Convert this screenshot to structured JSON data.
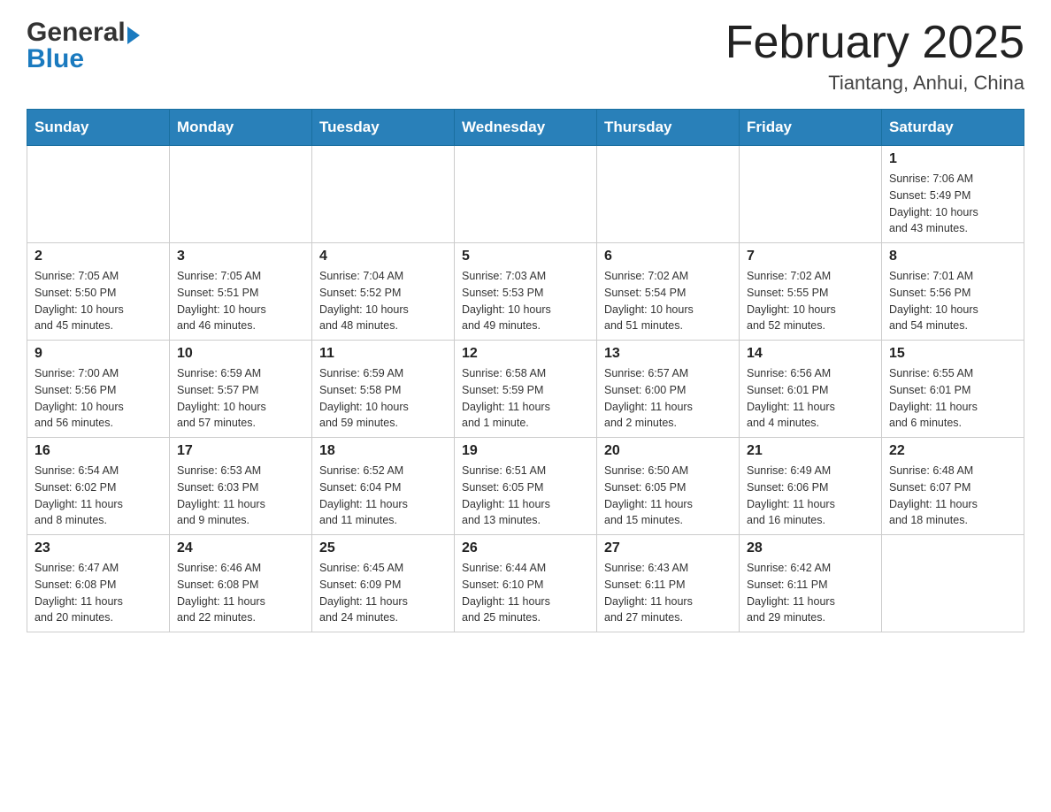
{
  "header": {
    "month_title": "February 2025",
    "location": "Tiantang, Anhui, China",
    "logo_general": "General",
    "logo_blue": "Blue"
  },
  "weekdays": [
    "Sunday",
    "Monday",
    "Tuesday",
    "Wednesday",
    "Thursday",
    "Friday",
    "Saturday"
  ],
  "weeks": [
    [
      {
        "day": "",
        "info": ""
      },
      {
        "day": "",
        "info": ""
      },
      {
        "day": "",
        "info": ""
      },
      {
        "day": "",
        "info": ""
      },
      {
        "day": "",
        "info": ""
      },
      {
        "day": "",
        "info": ""
      },
      {
        "day": "1",
        "info": "Sunrise: 7:06 AM\nSunset: 5:49 PM\nDaylight: 10 hours\nand 43 minutes."
      }
    ],
    [
      {
        "day": "2",
        "info": "Sunrise: 7:05 AM\nSunset: 5:50 PM\nDaylight: 10 hours\nand 45 minutes."
      },
      {
        "day": "3",
        "info": "Sunrise: 7:05 AM\nSunset: 5:51 PM\nDaylight: 10 hours\nand 46 minutes."
      },
      {
        "day": "4",
        "info": "Sunrise: 7:04 AM\nSunset: 5:52 PM\nDaylight: 10 hours\nand 48 minutes."
      },
      {
        "day": "5",
        "info": "Sunrise: 7:03 AM\nSunset: 5:53 PM\nDaylight: 10 hours\nand 49 minutes."
      },
      {
        "day": "6",
        "info": "Sunrise: 7:02 AM\nSunset: 5:54 PM\nDaylight: 10 hours\nand 51 minutes."
      },
      {
        "day": "7",
        "info": "Sunrise: 7:02 AM\nSunset: 5:55 PM\nDaylight: 10 hours\nand 52 minutes."
      },
      {
        "day": "8",
        "info": "Sunrise: 7:01 AM\nSunset: 5:56 PM\nDaylight: 10 hours\nand 54 minutes."
      }
    ],
    [
      {
        "day": "9",
        "info": "Sunrise: 7:00 AM\nSunset: 5:56 PM\nDaylight: 10 hours\nand 56 minutes."
      },
      {
        "day": "10",
        "info": "Sunrise: 6:59 AM\nSunset: 5:57 PM\nDaylight: 10 hours\nand 57 minutes."
      },
      {
        "day": "11",
        "info": "Sunrise: 6:59 AM\nSunset: 5:58 PM\nDaylight: 10 hours\nand 59 minutes."
      },
      {
        "day": "12",
        "info": "Sunrise: 6:58 AM\nSunset: 5:59 PM\nDaylight: 11 hours\nand 1 minute."
      },
      {
        "day": "13",
        "info": "Sunrise: 6:57 AM\nSunset: 6:00 PM\nDaylight: 11 hours\nand 2 minutes."
      },
      {
        "day": "14",
        "info": "Sunrise: 6:56 AM\nSunset: 6:01 PM\nDaylight: 11 hours\nand 4 minutes."
      },
      {
        "day": "15",
        "info": "Sunrise: 6:55 AM\nSunset: 6:01 PM\nDaylight: 11 hours\nand 6 minutes."
      }
    ],
    [
      {
        "day": "16",
        "info": "Sunrise: 6:54 AM\nSunset: 6:02 PM\nDaylight: 11 hours\nand 8 minutes."
      },
      {
        "day": "17",
        "info": "Sunrise: 6:53 AM\nSunset: 6:03 PM\nDaylight: 11 hours\nand 9 minutes."
      },
      {
        "day": "18",
        "info": "Sunrise: 6:52 AM\nSunset: 6:04 PM\nDaylight: 11 hours\nand 11 minutes."
      },
      {
        "day": "19",
        "info": "Sunrise: 6:51 AM\nSunset: 6:05 PM\nDaylight: 11 hours\nand 13 minutes."
      },
      {
        "day": "20",
        "info": "Sunrise: 6:50 AM\nSunset: 6:05 PM\nDaylight: 11 hours\nand 15 minutes."
      },
      {
        "day": "21",
        "info": "Sunrise: 6:49 AM\nSunset: 6:06 PM\nDaylight: 11 hours\nand 16 minutes."
      },
      {
        "day": "22",
        "info": "Sunrise: 6:48 AM\nSunset: 6:07 PM\nDaylight: 11 hours\nand 18 minutes."
      }
    ],
    [
      {
        "day": "23",
        "info": "Sunrise: 6:47 AM\nSunset: 6:08 PM\nDaylight: 11 hours\nand 20 minutes."
      },
      {
        "day": "24",
        "info": "Sunrise: 6:46 AM\nSunset: 6:08 PM\nDaylight: 11 hours\nand 22 minutes."
      },
      {
        "day": "25",
        "info": "Sunrise: 6:45 AM\nSunset: 6:09 PM\nDaylight: 11 hours\nand 24 minutes."
      },
      {
        "day": "26",
        "info": "Sunrise: 6:44 AM\nSunset: 6:10 PM\nDaylight: 11 hours\nand 25 minutes."
      },
      {
        "day": "27",
        "info": "Sunrise: 6:43 AM\nSunset: 6:11 PM\nDaylight: 11 hours\nand 27 minutes."
      },
      {
        "day": "28",
        "info": "Sunrise: 6:42 AM\nSunset: 6:11 PM\nDaylight: 11 hours\nand 29 minutes."
      },
      {
        "day": "",
        "info": ""
      }
    ]
  ]
}
